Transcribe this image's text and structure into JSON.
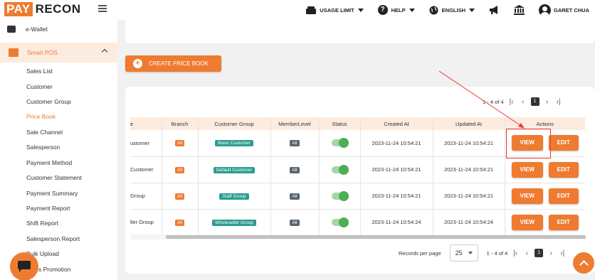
{
  "brand": {
    "part1": "PAY",
    "part2": "RECON"
  },
  "header": {
    "usage_limit": "USAGE LIMIT",
    "help": "HELP",
    "language": "ENGLISH",
    "user_name": "GARET CHUA"
  },
  "sidebar": {
    "wallet": "e-Wallet",
    "smart_pos": "Smart POS",
    "items": [
      {
        "label": "Sales List"
      },
      {
        "label": "Customer"
      },
      {
        "label": "Customer Group"
      },
      {
        "label": "Price Book",
        "active": true
      },
      {
        "label": "Sale Channel"
      },
      {
        "label": "Salesperson"
      },
      {
        "label": "Payment Method"
      },
      {
        "label": "Customer Statement"
      },
      {
        "label": "Payment Summary"
      },
      {
        "label": "Payment Report"
      },
      {
        "label": "Shift Report"
      },
      {
        "label": "Salesperson Report"
      },
      {
        "label": "Bulk Upload"
      },
      {
        "label": "Sales Promotion"
      }
    ]
  },
  "main": {
    "create_button": "CREATE PRICE BOOK",
    "pager_top": {
      "range": "1 - 4 of 4",
      "page": "1"
    },
    "table": {
      "headers": [
        "e",
        "Branch",
        "Customer Group",
        "MemberLevel",
        "Status",
        "Created At",
        "Updated At",
        "Actions"
      ],
      "rows": [
        {
          "name": "ustomer",
          "branch": "All",
          "customer_group": "Basic Customer",
          "member_level": "All",
          "status": "on",
          "created_at": "2023-11-24 10:54:21",
          "updated_at": "2023-11-24 10:54:21"
        },
        {
          "name": "Customer",
          "branch": "All",
          "customer_group": "Default Customer",
          "member_level": "All",
          "status": "on",
          "created_at": "2023-11-24 10:54:21",
          "updated_at": "2023-11-24 10:54:21"
        },
        {
          "name": "Group",
          "branch": "All",
          "customer_group": "Staff Group",
          "member_level": "All",
          "status": "on",
          "created_at": "2023-11-24 10:54:21",
          "updated_at": "2023-11-24 10:54:21"
        },
        {
          "name": "ller Group",
          "branch": "All",
          "customer_group": "Wholeseller Group",
          "member_level": "All",
          "status": "on",
          "created_at": "2023-11-24 10:54:24",
          "updated_at": "2023-11-24 10:54:24"
        }
      ],
      "view_label": "VIEW",
      "edit_label": "EDIT"
    },
    "footer": {
      "rows_per_page_label": "Records per page",
      "rows_per_page_value": "25",
      "range": "1 - 4 of 4",
      "page": "1"
    }
  },
  "colors": {
    "accent": "#ee7b30",
    "status_on": "#4caf50",
    "group_badge": "#2a9d8f",
    "annotation": "#e53935"
  }
}
